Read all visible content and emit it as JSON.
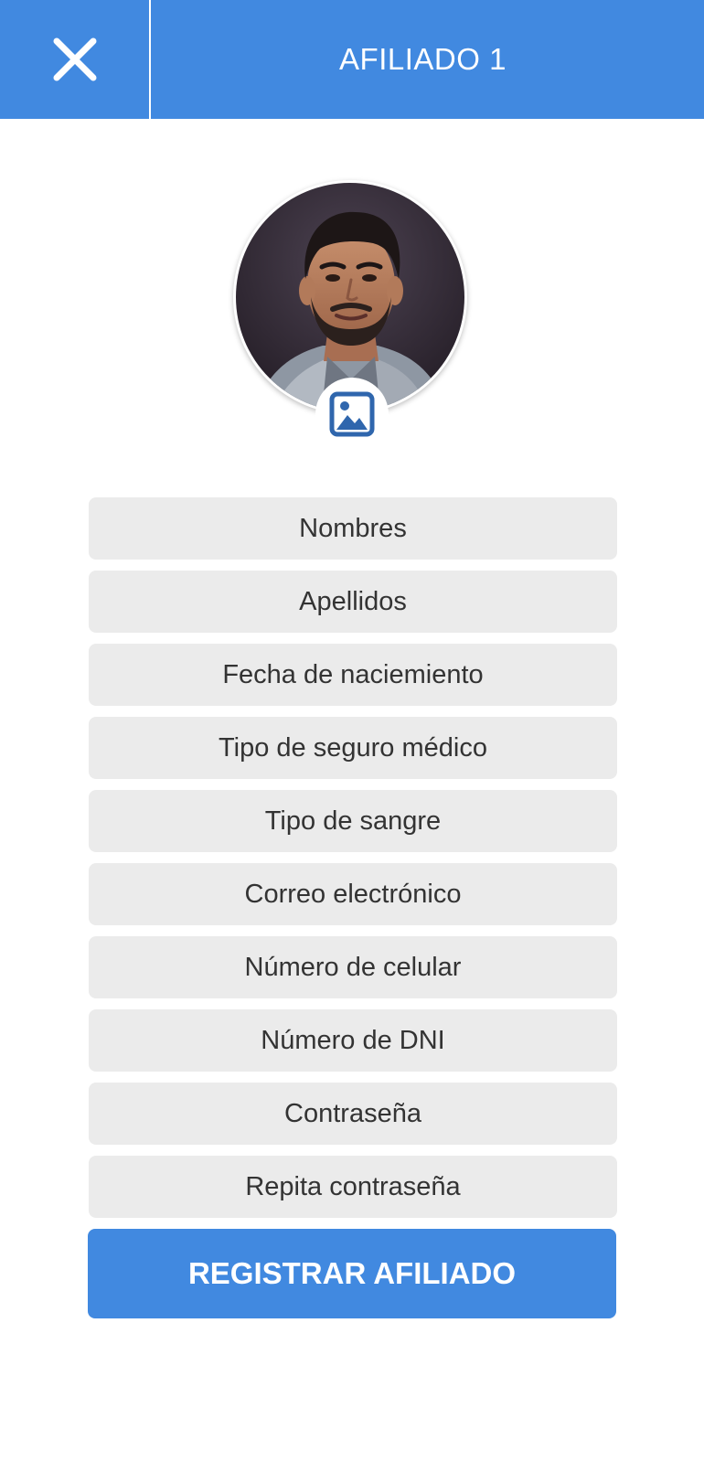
{
  "header": {
    "title": "AFILIADO 1",
    "close_icon": "close-icon"
  },
  "profile": {
    "avatar": "user-photo",
    "badge_icon": "image-icon"
  },
  "form": {
    "fields": [
      {
        "placeholder": "Nombres"
      },
      {
        "placeholder": "Apellidos"
      },
      {
        "placeholder": "Fecha de naciemiento"
      },
      {
        "placeholder": "Tipo de seguro médico"
      },
      {
        "placeholder": "Tipo de sangre"
      },
      {
        "placeholder": "Correo electrónico"
      },
      {
        "placeholder": "Número de celular"
      },
      {
        "placeholder": "Número de DNI"
      },
      {
        "placeholder": "Contraseña"
      },
      {
        "placeholder": "Repita contraseña"
      }
    ],
    "submit_label": "REGISTRAR AFILIADO"
  },
  "colors": {
    "primary": "#4189e0",
    "field_bg": "#ebebeb",
    "text": "#333333",
    "icon_blue": "#2f66ad"
  }
}
